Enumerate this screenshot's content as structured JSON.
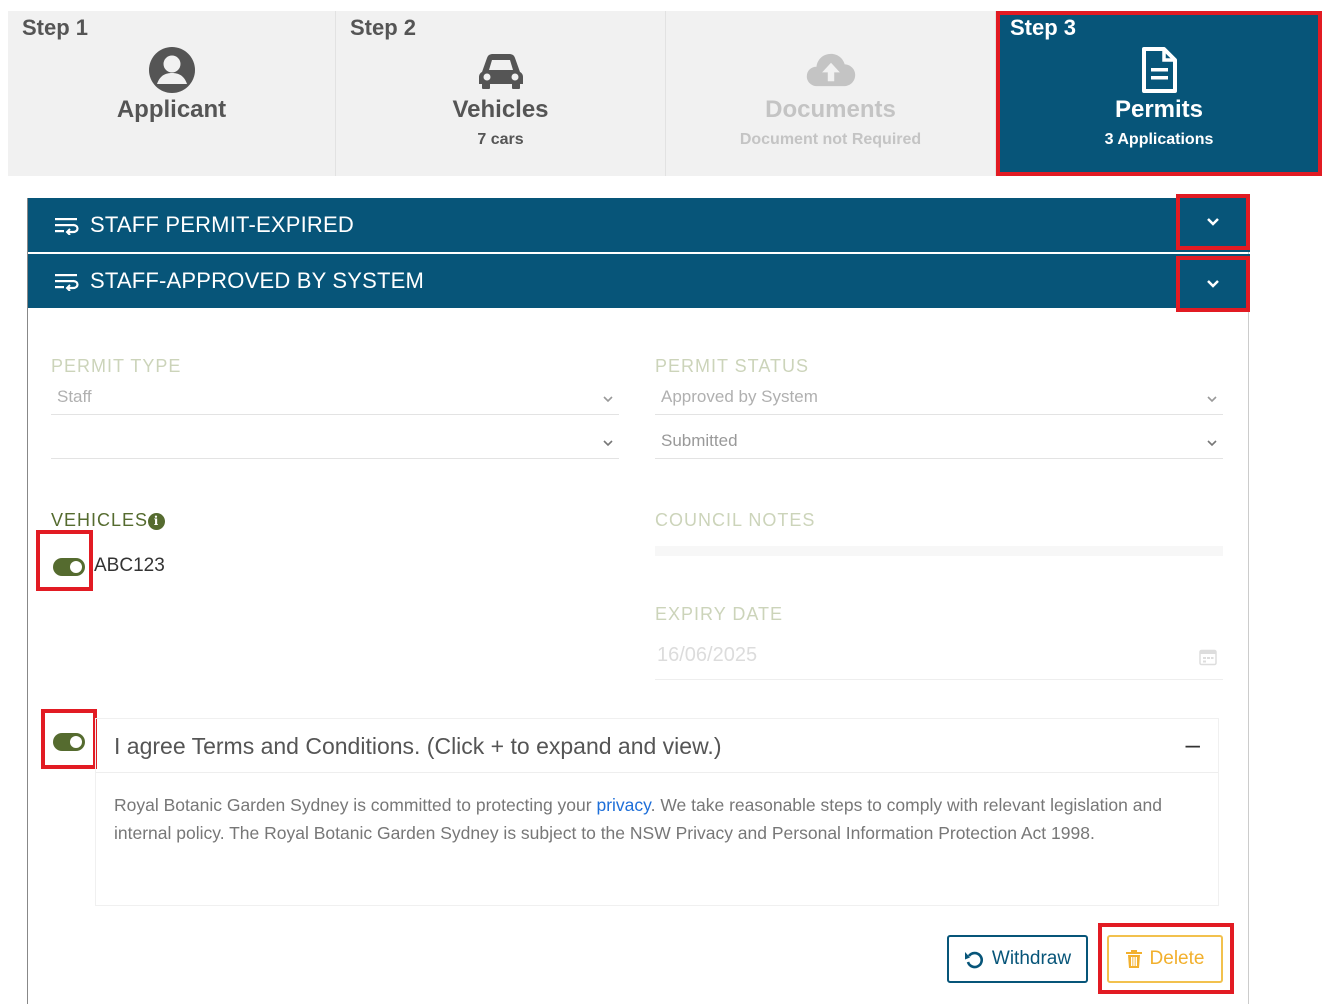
{
  "stepper": {
    "steps": [
      {
        "num": "Step 1",
        "title": "Applicant",
        "sub": "",
        "icon": "user-circle-icon",
        "state": "normal"
      },
      {
        "num": "Step 2",
        "title": "Vehicles",
        "sub": "7 cars",
        "icon": "car-icon",
        "state": "normal"
      },
      {
        "num": "",
        "title": "Documents",
        "sub": "Document not Required",
        "icon": "cloud-upload-icon",
        "state": "disabled"
      },
      {
        "num": "Step 3",
        "title": "Permits",
        "sub": "3 Applications",
        "icon": "document-icon",
        "state": "active"
      }
    ]
  },
  "accordion": {
    "items": [
      {
        "title": "STAFF PERMIT-EXPIRED"
      },
      {
        "title": "STAFF-APPROVED BY SYSTEM"
      }
    ]
  },
  "form": {
    "permit_type_label": "PERMIT TYPE",
    "permit_type_value": "Staff",
    "permit_subtype_value": "",
    "permit_status_label": "PERMIT STATUS",
    "permit_status_value": "Approved by System",
    "permit_substatus_value": "Submitted",
    "vehicles_label": "VEHICLES",
    "vehicles": [
      {
        "plate": "ABC123",
        "enabled": true
      }
    ],
    "council_notes_label": "COUNCIL NOTES",
    "expiry_date_label": "EXPIRY DATE",
    "expiry_date_value": "16/06/2025"
  },
  "terms": {
    "agreed": true,
    "title": "I agree Terms and Conditions. (Click + to expand and view.)",
    "collapse_symbol": "–",
    "body_part1": "Royal Botanic Garden Sydney is committed to protecting your ",
    "body_link": "privacy",
    "body_part2": ". We take reasonable steps to comply with relevant legislation and internal policy. The Royal Botanic Garden Sydney is subject to the NSW Privacy and Personal Information Protection Act 1998."
  },
  "actions": {
    "withdraw_label": "Withdraw",
    "delete_label": "Delete"
  },
  "colors": {
    "primary": "#075579",
    "highlight": "#e21b23",
    "toggle_on": "#556b2f",
    "delete": "#f2b02d"
  }
}
